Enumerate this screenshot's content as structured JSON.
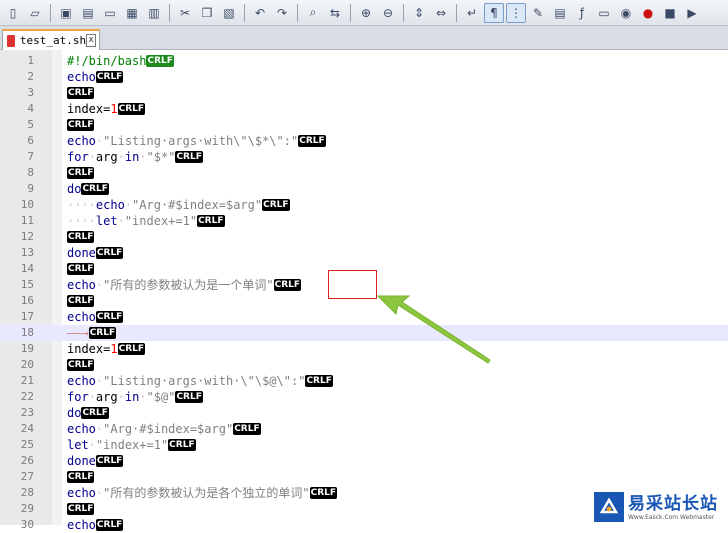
{
  "toolbar": {
    "icons": [
      "new-file-icon",
      "open-file-icon",
      "save-icon",
      "save-all-icon",
      "close-icon",
      "close-all-icon",
      "print-icon",
      "cut-icon",
      "copy-icon",
      "paste-icon",
      "undo-icon",
      "redo-icon",
      "find-icon",
      "replace-icon",
      "zoom-in-icon",
      "zoom-out-icon",
      "sync-v-icon",
      "sync-h-icon",
      "word-wrap-icon",
      "show-all-chars-icon",
      "indent-guide-icon",
      "udl-icon",
      "doc-map-icon",
      "function-list-icon",
      "folder-workspace-icon",
      "monitor-icon",
      "record-macro-icon",
      "stop-macro-icon",
      "play-macro-icon"
    ]
  },
  "tab": {
    "label": "test_at.sh",
    "close": "x"
  },
  "lines": [
    [
      [
        "cm",
        "#!/bin/bash"
      ],
      [
        "eolg",
        "CRLF"
      ]
    ],
    [
      [
        "kw",
        "echo"
      ],
      [
        "eol",
        "CRLF"
      ]
    ],
    [
      [
        "eol",
        "CRLF"
      ]
    ],
    [
      [
        "tx",
        "index="
      ],
      [
        "nm",
        "1"
      ],
      [
        "eol",
        "CRLF"
      ]
    ],
    [
      [
        "eol",
        "CRLF"
      ]
    ],
    [
      [
        "kw",
        "echo"
      ],
      [
        "ws",
        "·"
      ],
      [
        "st",
        "\"Listing·args·with\\\"\\$*\\\":\""
      ],
      [
        "eol",
        "CRLF"
      ]
    ],
    [
      [
        "kw",
        "for"
      ],
      [
        "ws",
        "·"
      ],
      [
        "tx",
        "arg"
      ],
      [
        "ws",
        "·"
      ],
      [
        "kw",
        "in"
      ],
      [
        "ws",
        "·"
      ],
      [
        "st",
        "\"$*\""
      ],
      [
        "eol",
        "CRLF"
      ]
    ],
    [
      [
        "eol",
        "CRLF"
      ]
    ],
    [
      [
        "kw",
        "do"
      ],
      [
        "eol",
        "CRLF"
      ]
    ],
    [
      [
        "ws",
        "····"
      ],
      [
        "kw",
        "echo"
      ],
      [
        "ws",
        "·"
      ],
      [
        "st",
        "\"Arg·#$index=$arg\""
      ],
      [
        "eol",
        "CRLF"
      ]
    ],
    [
      [
        "ws",
        "····"
      ],
      [
        "kw",
        "let"
      ],
      [
        "ws",
        "·"
      ],
      [
        "st",
        "\"index+=1\""
      ],
      [
        "eol",
        "CRLF"
      ]
    ],
    [
      [
        "eol",
        "CRLF"
      ]
    ],
    [
      [
        "kw",
        "done"
      ],
      [
        "eol",
        "CRLF"
      ]
    ],
    [
      [
        "eol",
        "CRLF"
      ]
    ],
    [
      [
        "kw",
        "echo"
      ],
      [
        "ws",
        "·"
      ],
      [
        "st",
        "\"所有的参数被认为是一个单词\""
      ],
      [
        "eol",
        "CRLF"
      ]
    ],
    [
      [
        "eol",
        "CRLF"
      ]
    ],
    [
      [
        "kw",
        "echo"
      ],
      [
        "eol",
        "CRLF"
      ]
    ],
    [
      [
        "tab",
        "——→"
      ],
      [
        "eol",
        "CRLF"
      ]
    ],
    [
      [
        "tx",
        "index="
      ],
      [
        "nm",
        "1"
      ],
      [
        "eol",
        "CRLF"
      ]
    ],
    [
      [
        "eol",
        "CRLF"
      ]
    ],
    [
      [
        "kw",
        "echo"
      ],
      [
        "ws",
        "·"
      ],
      [
        "st",
        "\"Listing·args·with·\\\"\\$@\\\":\""
      ],
      [
        "eol",
        "CRLF"
      ]
    ],
    [
      [
        "kw",
        "for"
      ],
      [
        "ws",
        "·"
      ],
      [
        "tx",
        "arg"
      ],
      [
        "ws",
        "·"
      ],
      [
        "kw",
        "in"
      ],
      [
        "ws",
        "·"
      ],
      [
        "st",
        "\"$@\""
      ],
      [
        "eol",
        "CRLF"
      ]
    ],
    [
      [
        "kw",
        "do"
      ],
      [
        "eol",
        "CRLF"
      ]
    ],
    [
      [
        "kw",
        "echo"
      ],
      [
        "ws",
        "·"
      ],
      [
        "st",
        "\"Arg·#$index=$arg\""
      ],
      [
        "eol",
        "CRLF"
      ]
    ],
    [
      [
        "kw",
        "let"
      ],
      [
        "ws",
        "·"
      ],
      [
        "st",
        "\"index+=1\""
      ],
      [
        "eol",
        "CRLF"
      ]
    ],
    [
      [
        "kw",
        "done"
      ],
      [
        "eol",
        "CRLF"
      ]
    ],
    [
      [
        "eol",
        "CRLF"
      ]
    ],
    [
      [
        "kw",
        "echo"
      ],
      [
        "ws",
        "·"
      ],
      [
        "st",
        "\"所有的参数被认为是各个独立的单词\""
      ],
      [
        "eol",
        "CRLF"
      ]
    ],
    [
      [
        "eol",
        "CRLF"
      ]
    ],
    [
      [
        "kw",
        "echo"
      ],
      [
        "eol",
        "CRLF"
      ]
    ]
  ],
  "current_line": 18,
  "watermark": {
    "title": "易采站长站",
    "sub": "Www.Easck.Com  Webmaster"
  },
  "colors": {
    "annotation_box": "#d42020",
    "annotation_arrow": "#8cc63f"
  }
}
